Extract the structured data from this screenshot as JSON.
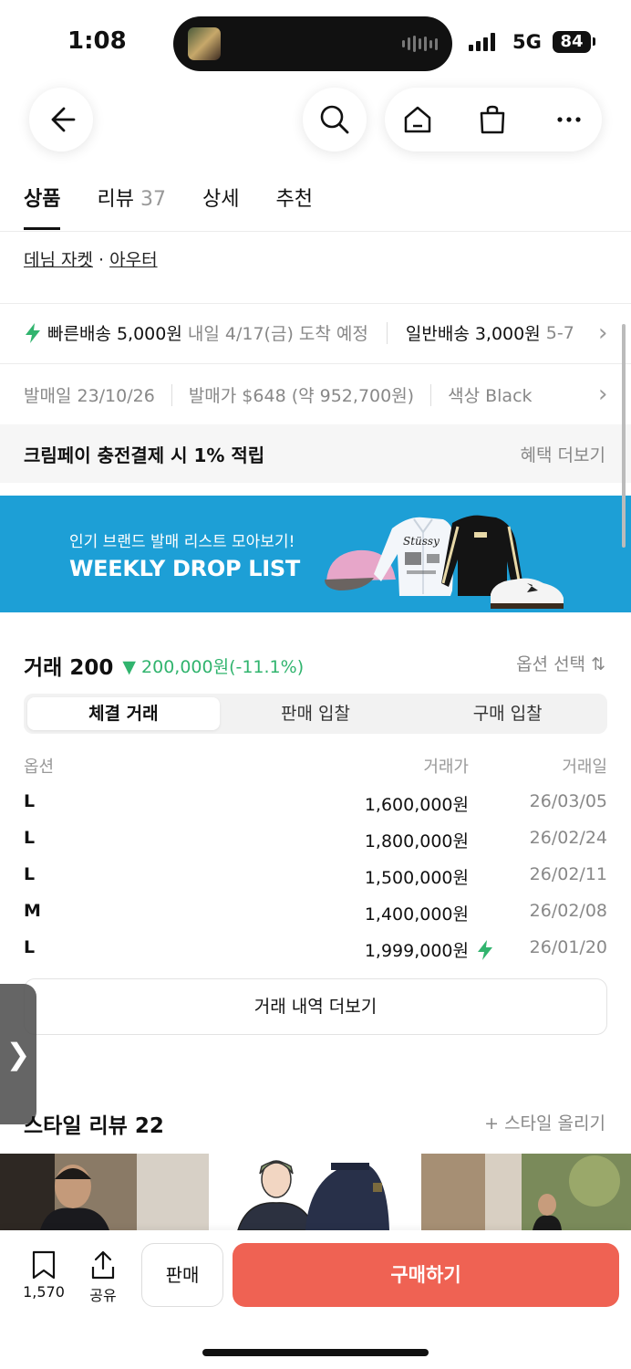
{
  "status_bar": {
    "time": "1:08",
    "network": "5G",
    "battery": "84"
  },
  "tabs": [
    {
      "label": "상품",
      "count": ""
    },
    {
      "label": "리뷰",
      "count": "37"
    },
    {
      "label": "상세",
      "count": ""
    },
    {
      "label": "추천",
      "count": ""
    }
  ],
  "breadcrumb": {
    "category": "데님 자켓",
    "separator": "·",
    "parent": "아우터"
  },
  "shipping": {
    "fast_label": "빠른배송 5,000원",
    "fast_eta": "내일 4/17(금) 도착 예정",
    "normal_label": "일반배송 3,000원",
    "normal_eta": "5-7"
  },
  "release": {
    "date": "발매일 23/10/26",
    "price": "발매가 $648 (약 952,700원)",
    "color": "색상 Black"
  },
  "kream_pay": {
    "text": "크림페이 충전결제 시 1% 적립",
    "more": "혜택 더보기"
  },
  "banner": {
    "subtitle": "인기 브랜드 발매 리스트 모아보기!",
    "title": "WEEKLY DROP LIST"
  },
  "trade": {
    "title": "거래 200",
    "change_arrow": "▼",
    "change": "200,000원(-11.1%)",
    "option_select": "옵션 선택 ⇅",
    "segments": [
      "체결 거래",
      "판매 입찰",
      "구매 입찰"
    ],
    "columns": [
      "옵션",
      "거래가",
      "거래일"
    ],
    "rows": [
      {
        "option": "L",
        "price": "1,600,000원",
        "date": "26/03/05",
        "fast": false
      },
      {
        "option": "L",
        "price": "1,800,000원",
        "date": "26/02/24",
        "fast": false
      },
      {
        "option": "L",
        "price": "1,500,000원",
        "date": "26/02/11",
        "fast": false
      },
      {
        "option": "M",
        "price": "1,400,000원",
        "date": "26/02/08",
        "fast": false
      },
      {
        "option": "L",
        "price": "1,999,000원",
        "date": "26/01/20",
        "fast": true
      }
    ],
    "more_button": "거래 내역 더보기"
  },
  "style_review": {
    "title": "스타일 리뷰 22",
    "add": "+ 스타일 올리기"
  },
  "bottom_bar": {
    "bookmark_count": "1,570",
    "share_label": "공유",
    "sell_label": "판매",
    "buy_label": "구매하기"
  },
  "side_handle": "❯",
  "colors": {
    "accent_buy": "#ef6253",
    "price_down": "#31b46e",
    "banner_bg": "#1d9fd6"
  },
  "icons": [
    "back-arrow-icon",
    "search-icon",
    "home-icon",
    "shopping-bag-icon",
    "more-icon",
    "lightning-icon",
    "chevron-right-icon",
    "bookmark-icon",
    "share-icon"
  ]
}
